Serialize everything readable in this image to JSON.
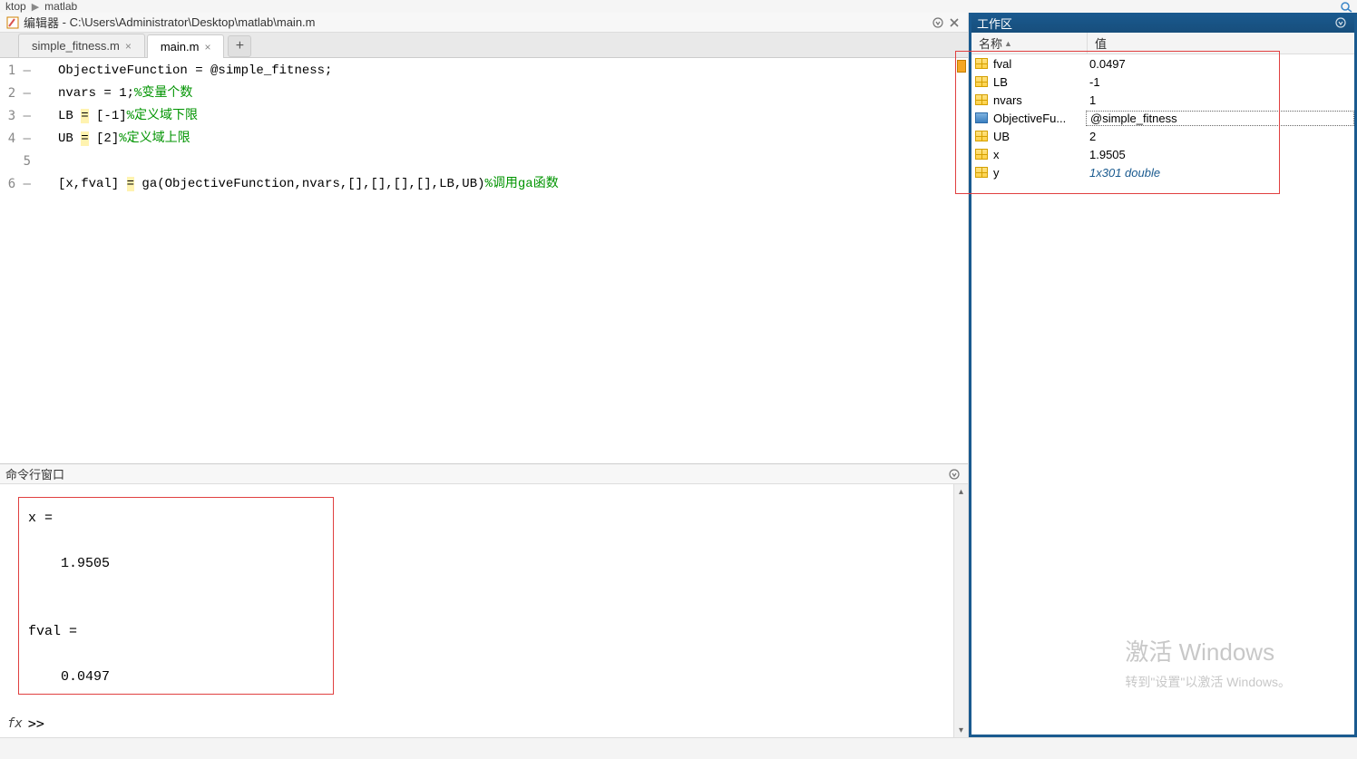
{
  "breadcrumb": {
    "part1": "ktop",
    "part2": "matlab"
  },
  "editor": {
    "title_prefix": "编辑器",
    "title_path": "C:\\Users\\Administrator\\Desktop\\matlab\\main.m",
    "tabs": [
      {
        "label": "simple_fitness.m",
        "active": false
      },
      {
        "label": "main.m",
        "active": true
      }
    ],
    "lines": [
      {
        "n": "1",
        "dash": true,
        "code": "ObjectiveFunction = @simple_fitness;",
        "comment": ""
      },
      {
        "n": "2",
        "dash": true,
        "code": "nvars = 1;",
        "comment": "%变量个数"
      },
      {
        "n": "3",
        "dash": true,
        "code_pre": "LB ",
        "op": "=",
        "code_post": " [-1]",
        "comment": "%定义域下限"
      },
      {
        "n": "4",
        "dash": true,
        "code_pre": "UB ",
        "op": "=",
        "code_post": " [2]",
        "comment": "%定义域上限"
      },
      {
        "n": "5",
        "dash": false,
        "code": "",
        "comment": ""
      },
      {
        "n": "6",
        "dash": true,
        "code_pre": "[x,fval] ",
        "op": "=",
        "code_post": " ga(ObjectiveFunction,nvars,[],[],[],[],LB,UB)",
        "comment": "%调用ga函数"
      }
    ]
  },
  "command": {
    "title": "命令行窗口",
    "output": "x =\n\n    1.9505\n\n\nfval =\n\n    0.0497",
    "prompt_fx": "fx",
    "prompt": ">>"
  },
  "workspace": {
    "title": "工作区",
    "col_name": "名称",
    "col_value": "值",
    "vars": [
      {
        "name": "fval",
        "value": "0.0497",
        "type": "num"
      },
      {
        "name": "LB",
        "value": "-1",
        "type": "num"
      },
      {
        "name": "nvars",
        "value": "1",
        "type": "num"
      },
      {
        "name": "ObjectiveFu...",
        "value": "@simple_fitness",
        "type": "fn",
        "selected": true
      },
      {
        "name": "UB",
        "value": "2",
        "type": "num"
      },
      {
        "name": "x",
        "value": "1.9505",
        "type": "num"
      },
      {
        "name": "y",
        "value": "1x301 double",
        "type": "num",
        "link": true
      }
    ]
  },
  "watermark": {
    "line1": "激活 Windows",
    "line2": "转到\"设置\"以激活 Windows。"
  }
}
